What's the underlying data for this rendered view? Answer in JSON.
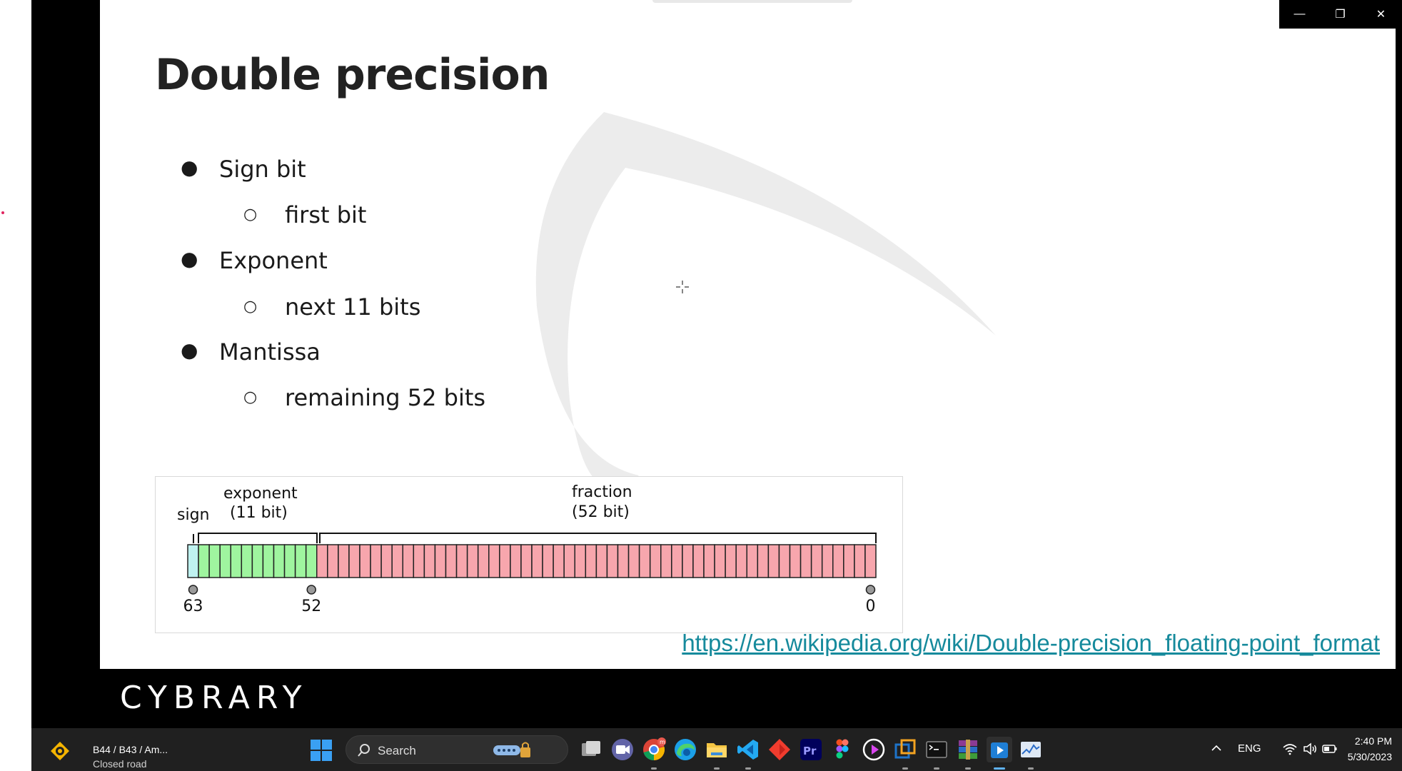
{
  "slide": {
    "title": "Double precision",
    "bullets": [
      {
        "text": "Sign bit",
        "sub": "first bit"
      },
      {
        "text": "Exponent",
        "sub": "next 11 bits"
      },
      {
        "text": "Mantissa",
        "sub": "remaining 52 bits"
      }
    ],
    "diagram": {
      "sign_label": "sign",
      "exponent_label_1": "exponent",
      "exponent_label_2": "(11 bit)",
      "fraction_label_1": "fraction",
      "fraction_label_2": "(52 bit)",
      "markers": [
        "63",
        "52",
        "0"
      ],
      "sign_bits": 1,
      "exponent_bits": 11,
      "fraction_bits": 52,
      "colors": {
        "sign": "#bff2f0",
        "exponent": "#9ff59f",
        "fraction": "#f7a6ad"
      }
    },
    "link": "https://en.wikipedia.org/wiki/Double-precision_floating-point_format"
  },
  "brand": "CYBRARY",
  "window_controls": {
    "minimize": "—",
    "restore": "❐",
    "close": "✕"
  },
  "taskbar": {
    "weather_line1": "B44 / B43 / Am...",
    "weather_line2": "Closed road",
    "search_label": "Search",
    "apps": [
      "task-view",
      "teams-meet",
      "chrome",
      "edge",
      "file-explorer",
      "vs-code",
      "git-gui",
      "premiere-pro",
      "figma",
      "media-player",
      "virtualbox",
      "terminal",
      "winrar",
      "video-player",
      "task-manager"
    ],
    "language": "ENG",
    "time": "2:40 PM",
    "date": "5/30/2023"
  },
  "colors": {
    "link": "#168a9c",
    "taskbar": "#202020",
    "accent": "#5fb2f2"
  }
}
